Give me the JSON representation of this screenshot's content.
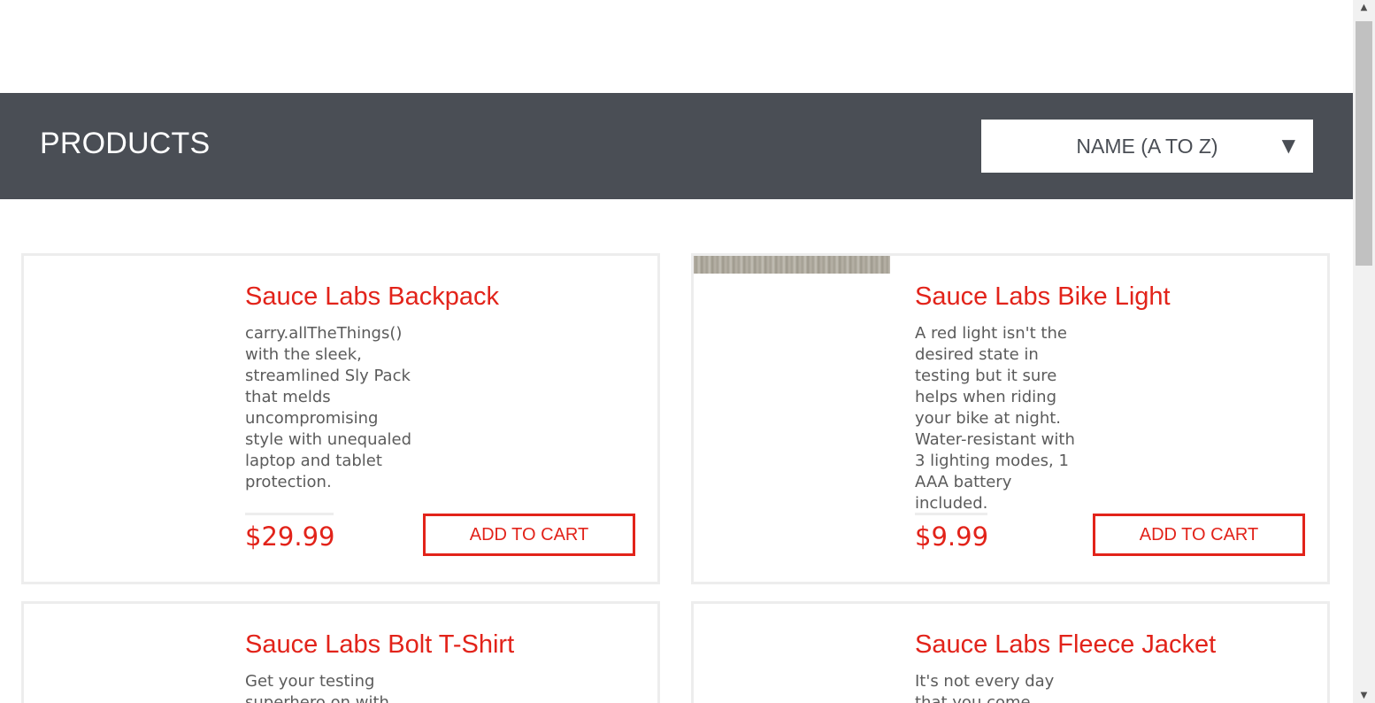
{
  "header": {
    "title": "PRODUCTS",
    "sort": {
      "selected": "NAME (A TO Z)",
      "arrow": "▼"
    }
  },
  "products": [
    {
      "name": "Sauce Labs Backpack",
      "description": "carry.allTheThings() with the sleek, streamlined Sly Pack that melds uncompromising style with unequaled laptop and tablet protection.",
      "price": "$29.99",
      "button": "ADD TO CART"
    },
    {
      "name": "Sauce Labs Bike Light",
      "description": "A red light isn't the desired state in testing but it sure helps when riding your bike at night. Water-resistant with 3 lighting modes, 1 AAA battery included.",
      "price": "$9.99",
      "button": "ADD TO CART"
    },
    {
      "name": "Sauce Labs Bolt T-Shirt",
      "description": "Get your testing superhero on with",
      "price": "",
      "button": ""
    },
    {
      "name": "Sauce Labs Fleece Jacket",
      "description": "It's not every day that you come",
      "price": "",
      "button": ""
    }
  ],
  "scrollbar": {
    "up_icon": "▲",
    "down_icon": "▼"
  },
  "colors": {
    "accent": "#e2231a",
    "header_bg": "#4a4e55",
    "card_border": "#ededed",
    "text": "#5b5b5b"
  }
}
